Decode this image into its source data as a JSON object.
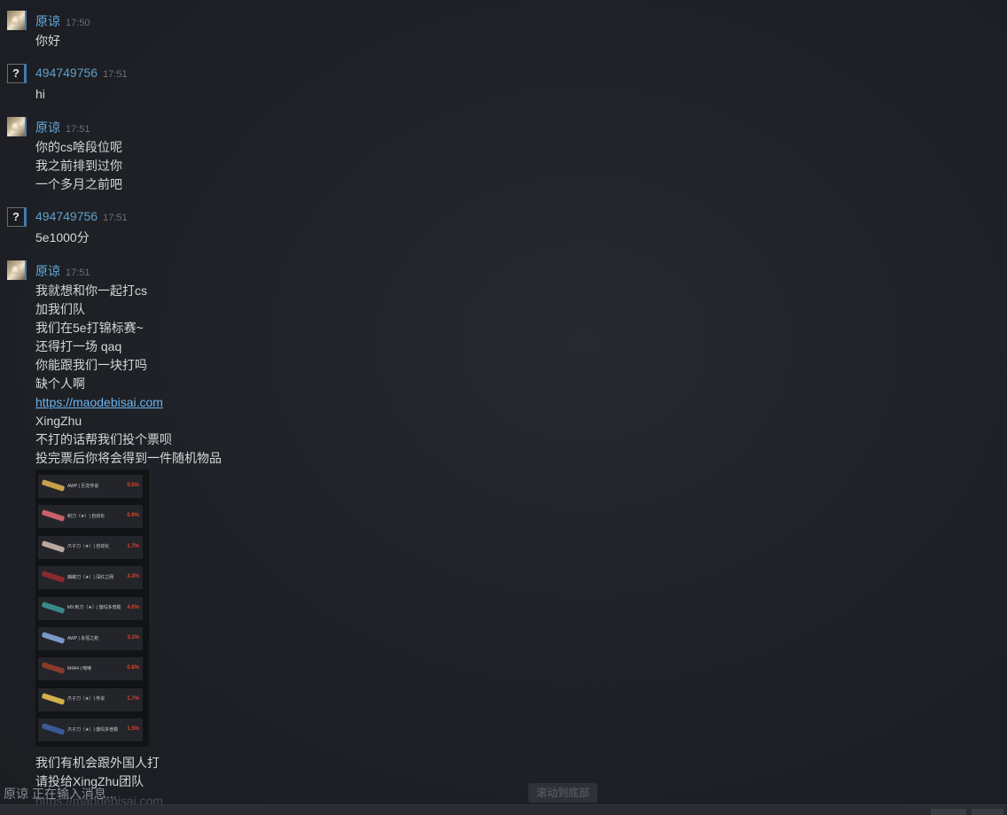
{
  "messages": [
    {
      "sender": "原谅",
      "avatar": "user-avatar-photo",
      "time": "17:50",
      "lines": [
        "你好"
      ]
    },
    {
      "sender": "494749756",
      "avatar": "question-mark-icon",
      "time": "17:51",
      "lines": [
        "hi"
      ]
    },
    {
      "sender": "原谅",
      "avatar": "user-avatar-photo",
      "time": "17:51",
      "lines": [
        "你的cs啥段位呢",
        "我之前排到过你",
        "一个多月之前吧"
      ]
    },
    {
      "sender": "494749756",
      "avatar": "question-mark-icon",
      "time": "17:51",
      "lines": [
        "5e1000分"
      ]
    },
    {
      "sender": "原谅",
      "avatar": "user-avatar-photo",
      "time": "17:51",
      "lines": [
        "我就想和你一起打cs",
        "加我们队",
        "我们在5e打锦标赛~",
        "还得打一场 qaq",
        "你能跟我们一块打吗",
        "缺个人啊"
      ],
      "link": "https://maodebisai.com",
      "lines_after_link": [
        "XingZhu",
        "不打的话帮我们投个票呗",
        "投完票后你将会得到一件随机物品"
      ],
      "lines_after_image": [
        "我们有机会跟外国人打",
        "请投给XingZhu团队"
      ],
      "faded_line": "https://maodebisai.com"
    }
  ],
  "embedded_image": {
    "items": [
      {
        "name": "AWP | 巨龙传说",
        "pct": "0.5%",
        "color": "#c9a04a"
      },
      {
        "name": "刺刀（★）| 自动化",
        "pct": "0.9%",
        "color": "#c8606a"
      },
      {
        "name": "爪子刀（★）| 自动化",
        "pct": "1.7%",
        "color": "#b9a9a0"
      },
      {
        "name": "蝴蝶刀（★）| 深红之网",
        "pct": "4.3%",
        "color": "#8a2a2a"
      },
      {
        "name": "M9 刺刀（★）| 伽玛多普勒",
        "pct": "4.6%",
        "color": "#3a8a8a"
      },
      {
        "name": "AWP | 永恒之枪",
        "pct": "3.1%",
        "color": "#7a98c8"
      },
      {
        "name": "M4A4 | 咆哮",
        "pct": "0.8%",
        "color": "#8a3a2a"
      },
      {
        "name": "爪子刀（★）| 传说",
        "pct": "1.7%",
        "color": "#d4b04a"
      },
      {
        "name": "爪子刀（★）| 伽玛多普勒",
        "pct": "1.5%",
        "color": "#3a5a9a"
      }
    ]
  },
  "status": {
    "typing": "原谅 正在输入消息...",
    "scroll_button": "滚动到底部"
  }
}
